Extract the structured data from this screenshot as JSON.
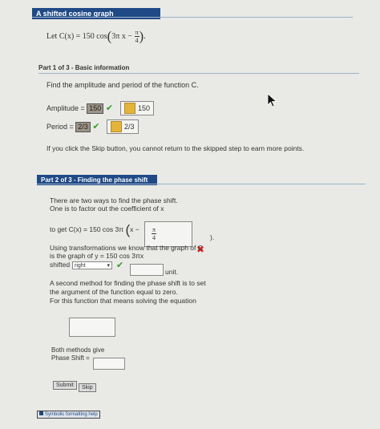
{
  "problem": {
    "title": "A shifted cosine graph",
    "function_text": "Let C(x) = 150 cos(3π x − π/4).",
    "function_prefix": "Let C(x) = 150 cos",
    "arg_term": "3π x −",
    "frac_num": "π",
    "frac_den": "4",
    "end": "."
  },
  "part1": {
    "header": "Part 1 of 3 - Basic information",
    "instruction": "Find the amplitude and period of the function C.",
    "amplitude_label": "Amplitude =",
    "amplitude_value": "150",
    "amplitude_answer": "150",
    "period_label": "Period =",
    "period_value": "2/3",
    "period_answer": "2/3"
  },
  "skip_notice": "If you click the Skip button, you cannot return to the skipped step to earn more points.",
  "part2": {
    "header": "Part 2 of 3 - Finding the phase shift",
    "intro_line1": "There are two ways to find the phase shift.",
    "intro_line2": "One is to factor out the coefficient of x",
    "factor_prefix": "to get C(x) = 150 cos 3π",
    "factor_open": "x −",
    "factor_num": "π",
    "factor_den": "4",
    "factor_close": ").",
    "transform_line1": "Using transformations we know that the graph of C",
    "transform_line2": "is the graph of y = 150 cos 3πx",
    "shifted_label": "shifted",
    "shift_direction": "right",
    "unit_label": "unit.",
    "method2_line1": "A second method for finding the phase shift is to set",
    "method2_line2": "the argument of the function equal to zero.",
    "method2_line3": "For this function that means solving the equation",
    "both_methods": "Both methods give",
    "phase_shift_label": "Phase Shift =",
    "submit_label": "Submit",
    "skip_label": "Skip"
  },
  "footer": {
    "help_link": "Symbolic formatting help"
  }
}
